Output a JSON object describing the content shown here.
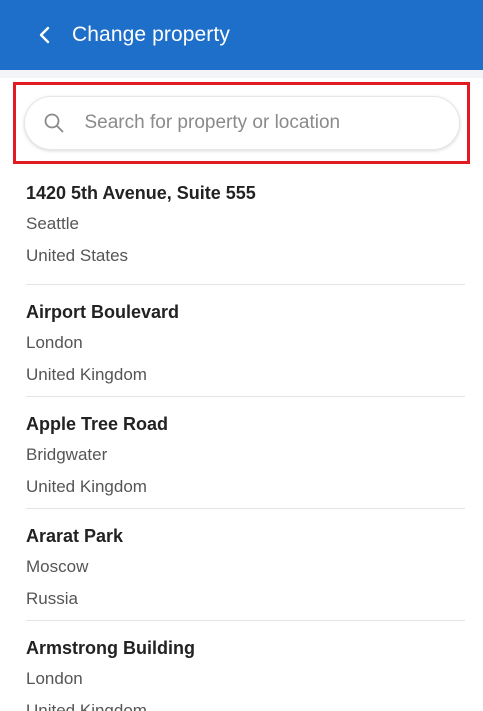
{
  "header": {
    "title": "Change property",
    "back_icon": "chevron-left-icon",
    "background_color": "#1e6fc9"
  },
  "search": {
    "placeholder": "Search for property or location",
    "value": "",
    "icon": "search-icon",
    "highlight_color": "#e21b23"
  },
  "properties": [
    {
      "name": "1420 5th Avenue, Suite 555",
      "city": "Seattle",
      "country": "United States"
    },
    {
      "name": "Airport Boulevard",
      "city": "London",
      "country": "United Kingdom"
    },
    {
      "name": "Apple Tree Road",
      "city": "Bridgwater",
      "country": "United Kingdom"
    },
    {
      "name": "Ararat Park",
      "city": "Moscow",
      "country": "Russia"
    },
    {
      "name": "Armstrong Building",
      "city": "London",
      "country": "United Kingdom"
    }
  ]
}
